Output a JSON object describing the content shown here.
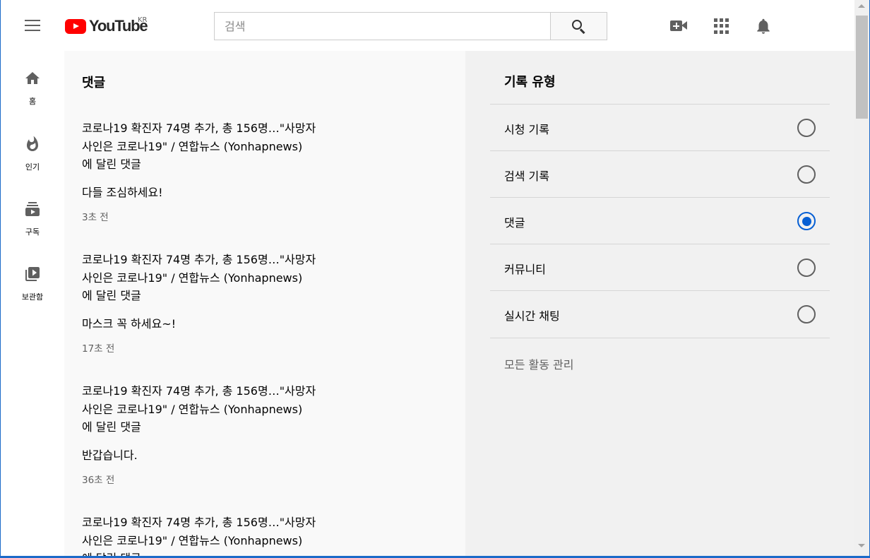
{
  "header": {
    "logo_text": "YouTube",
    "region": "KR",
    "search_placeholder": "검색",
    "search_value": ""
  },
  "guide": {
    "items": [
      {
        "label": "홈",
        "icon": "home-icon"
      },
      {
        "label": "인기",
        "icon": "trending-icon"
      },
      {
        "label": "구독",
        "icon": "subscriptions-icon"
      },
      {
        "label": "보관함",
        "icon": "library-icon"
      }
    ]
  },
  "feed": {
    "title": "댓글",
    "comments": [
      {
        "video_line1": "코로나19 확진자 74명 추가, 총 156명…\"사망자",
        "video_line2": "사인은 코로나19\" / 연합뉴스 (Yonhapnews)",
        "suffix": "에 달린 댓글",
        "text": "다들 조심하세요!",
        "time": "3초 전"
      },
      {
        "video_line1": "코로나19 확진자 74명 추가, 총 156명…\"사망자",
        "video_line2": "사인은 코로나19\" / 연합뉴스 (Yonhapnews)",
        "suffix": "에 달린 댓글",
        "text": "마스크 꼭 하세요~!",
        "time": "17초 전"
      },
      {
        "video_line1": "코로나19 확진자 74명 추가, 총 156명…\"사망자",
        "video_line2": "사인은 코로나19\" / 연합뉴스 (Yonhapnews)",
        "suffix": "에 달린 댓글",
        "text": "반갑습니다.",
        "time": "36초 전"
      },
      {
        "video_line1": "코로나19 확진자 74명 추가, 총 156명…\"사망자",
        "video_line2": "사인은 코로나19\" / 연합뉴스 (Yonhapnews)",
        "suffix": "에 달린 댓글",
        "text": "",
        "time": ""
      }
    ]
  },
  "history_panel": {
    "title": "기록 유형",
    "options": [
      {
        "label": "시청 기록",
        "selected": false
      },
      {
        "label": "검색 기록",
        "selected": false
      },
      {
        "label": "댓글",
        "selected": true
      },
      {
        "label": "커뮤니티",
        "selected": false
      },
      {
        "label": "실시간 채팅",
        "selected": false
      }
    ],
    "manage_link": "모든 활동 관리"
  },
  "colors": {
    "brand_red": "#ff0000",
    "selected_blue": "#065fd4",
    "icon_gray": "#606060"
  }
}
